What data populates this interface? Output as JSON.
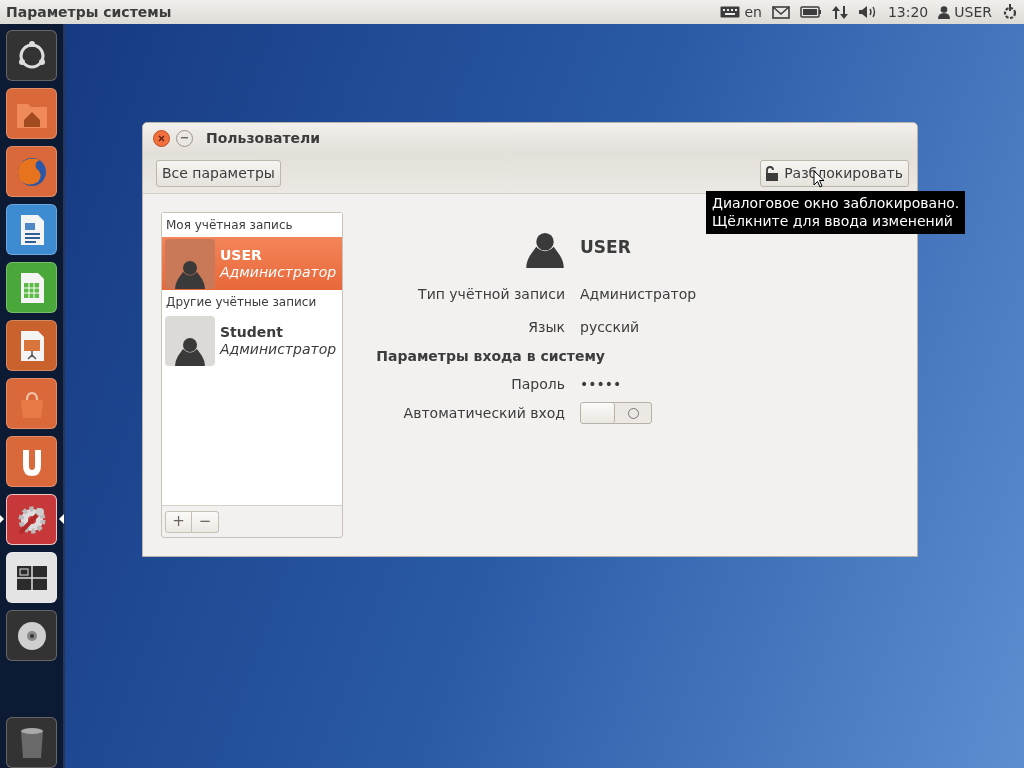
{
  "top_panel": {
    "title": "Параметры системы",
    "keyboard_layout": "en",
    "clock": "13:20",
    "user": "USER"
  },
  "launcher": {
    "items": [
      {
        "kind": "dash",
        "focused": false
      },
      {
        "kind": "folder",
        "focused": false
      },
      {
        "kind": "browser",
        "focused": false
      },
      {
        "kind": "writer",
        "focused": false
      },
      {
        "kind": "calc",
        "focused": false
      },
      {
        "kind": "impress",
        "focused": false
      },
      {
        "kind": "store",
        "focused": false
      },
      {
        "kind": "ubuntuone",
        "focused": false
      },
      {
        "kind": "settings",
        "focused": true
      },
      {
        "kind": "workspaces",
        "focused": false
      },
      {
        "kind": "disc",
        "focused": false
      },
      {
        "kind": "trash",
        "focused": false
      }
    ]
  },
  "window": {
    "title": "Пользователи",
    "toolbar": {
      "all_settings_button": "Все параметры",
      "unlock_button": "Разблокировать"
    },
    "tooltip": [
      "Диалоговое окно заблокировано.",
      "Щёлкните для ввода изменений"
    ],
    "accounts": [
      {
        "heading": "Моя учётная запись",
        "users": [
          {
            "name": "USER",
            "role": "Администратор",
            "selected": true
          }
        ]
      },
      {
        "heading": "Другие учётные записи",
        "users": [
          {
            "name": "Student",
            "role": "Администратор",
            "selected": false
          }
        ]
      }
    ],
    "list_buttons": [
      "+",
      "−"
    ],
    "details": {
      "user_name": "USER",
      "rows": [
        {
          "kind": "value",
          "label": "Тип учётной записи",
          "value": "Администратор"
        },
        {
          "kind": "value",
          "label": "Язык",
          "value": "русский"
        },
        {
          "kind": "heading",
          "label": "Параметры входа в систему"
        },
        {
          "kind": "value",
          "label": "Пароль",
          "value": "•••••"
        },
        {
          "kind": "switch",
          "label": "Автоматический вход",
          "on": false
        }
      ]
    }
  }
}
